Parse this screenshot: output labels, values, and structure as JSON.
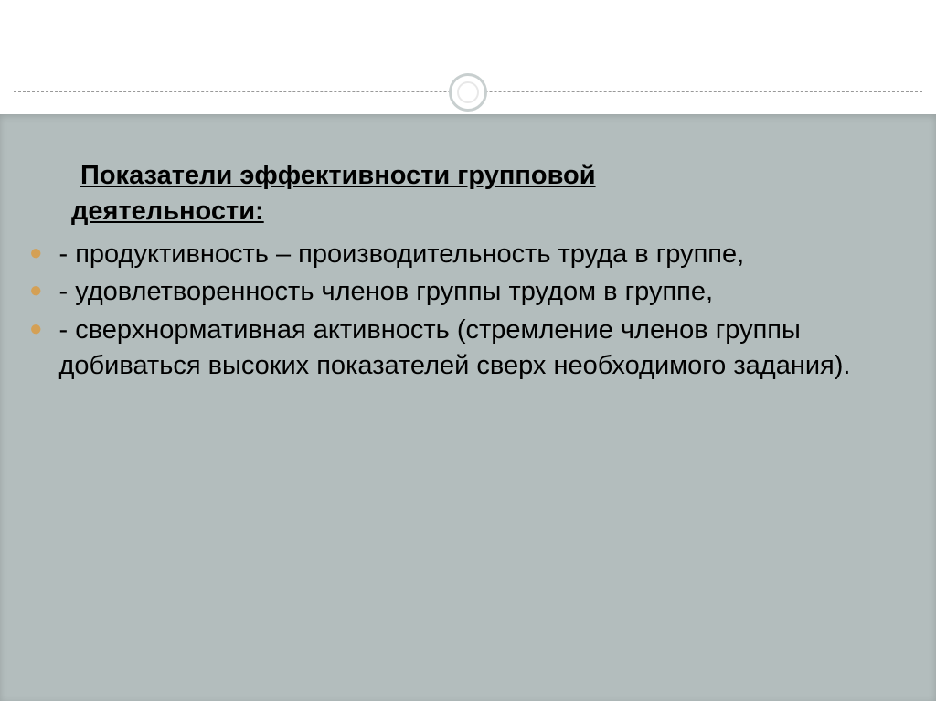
{
  "title_line1": "Показатели эффективности групповой",
  "title_line2": "деятельности:",
  "bullets": [
    "- продуктивность – производительность труда в группе,",
    "- удовлетворенность членов группы трудом в группе,",
    "- сверхнормативная активность (стремление членов группы добиваться высоких показателей сверх необходимого задания)."
  ]
}
